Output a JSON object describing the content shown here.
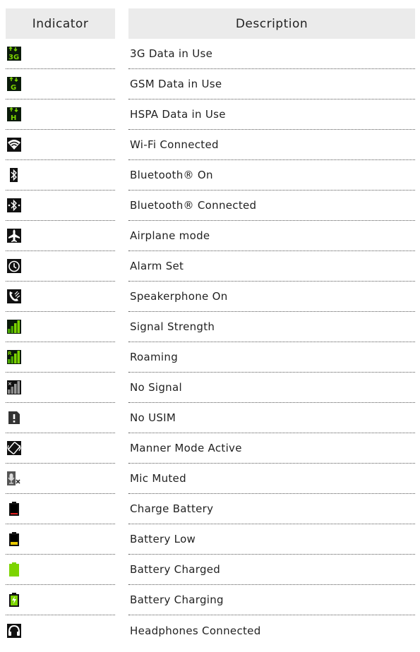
{
  "header": {
    "indicator": "Indicator",
    "description": "Description"
  },
  "rows": [
    {
      "icon": "3g-data-icon",
      "label": "3G Data in Use"
    },
    {
      "icon": "gsm-data-icon",
      "label": "GSM Data in Use"
    },
    {
      "icon": "hspa-data-icon",
      "label": "HSPA Data in Use"
    },
    {
      "icon": "wifi-icon",
      "label": "Wi-Fi Connected"
    },
    {
      "icon": "bluetooth-icon",
      "label": "Bluetooth® On"
    },
    {
      "icon": "bluetooth-connected-icon",
      "label": "Bluetooth® Connected"
    },
    {
      "icon": "airplane-icon",
      "label": "Airplane mode"
    },
    {
      "icon": "alarm-icon",
      "label": "Alarm Set"
    },
    {
      "icon": "speakerphone-icon",
      "label": "Speakerphone On"
    },
    {
      "icon": "signal-strength-icon",
      "label": "Signal Strength"
    },
    {
      "icon": "roaming-icon",
      "label": "Roaming"
    },
    {
      "icon": "no-signal-icon",
      "label": "No Signal"
    },
    {
      "icon": "no-usim-icon",
      "label": "No USIM"
    },
    {
      "icon": "manner-mode-icon",
      "label": "Manner Mode Active"
    },
    {
      "icon": "mic-muted-icon",
      "label": "Mic Muted"
    },
    {
      "icon": "charge-battery-icon",
      "label": "Charge Battery"
    },
    {
      "icon": "battery-low-icon",
      "label": "Battery Low"
    },
    {
      "icon": "battery-charged-icon",
      "label": "Battery Charged"
    },
    {
      "icon": "battery-charging-icon",
      "label": "Battery Charging"
    },
    {
      "icon": "headphones-icon",
      "label": "Headphones Connected"
    }
  ]
}
